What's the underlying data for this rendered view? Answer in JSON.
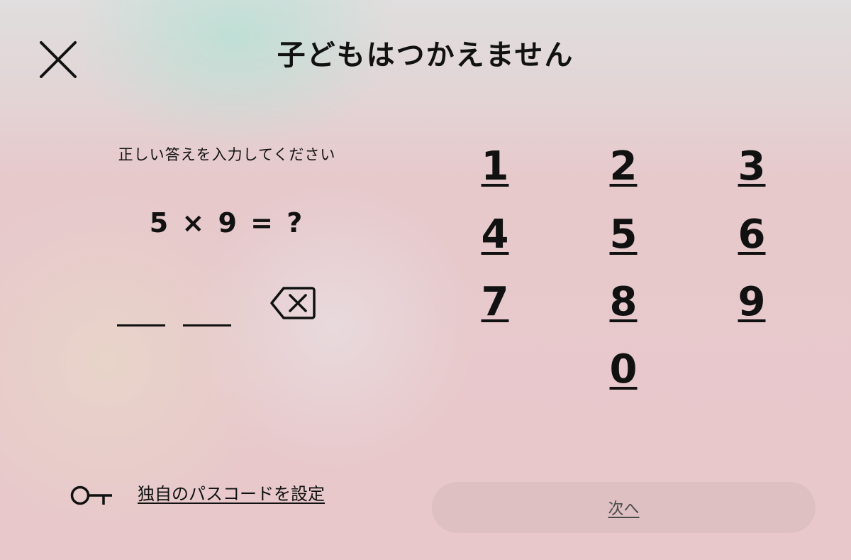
{
  "header": {
    "title": "子どもはつかえません",
    "close_icon": "close-icon"
  },
  "quiz": {
    "instruction": "正しい答えを入力してください",
    "question": "5 × 9 = ?",
    "answer_slots": [
      "",
      ""
    ],
    "backspace_icon": "backspace-icon"
  },
  "keypad": {
    "keys": [
      "1",
      "2",
      "3",
      "4",
      "5",
      "6",
      "7",
      "8",
      "9",
      "0"
    ]
  },
  "footer": {
    "passcode_icon": "key-icon",
    "passcode_label": "独自のパスコードを設定",
    "next_label": "次へ"
  },
  "colors": {
    "text": "#111111",
    "background_pink": "#e8c8cb",
    "background_gray": "#e0dede",
    "mint_glow": "#b4e1d4",
    "next_button_bg": "#d8b9bd",
    "next_label": "#4a4a4a"
  }
}
